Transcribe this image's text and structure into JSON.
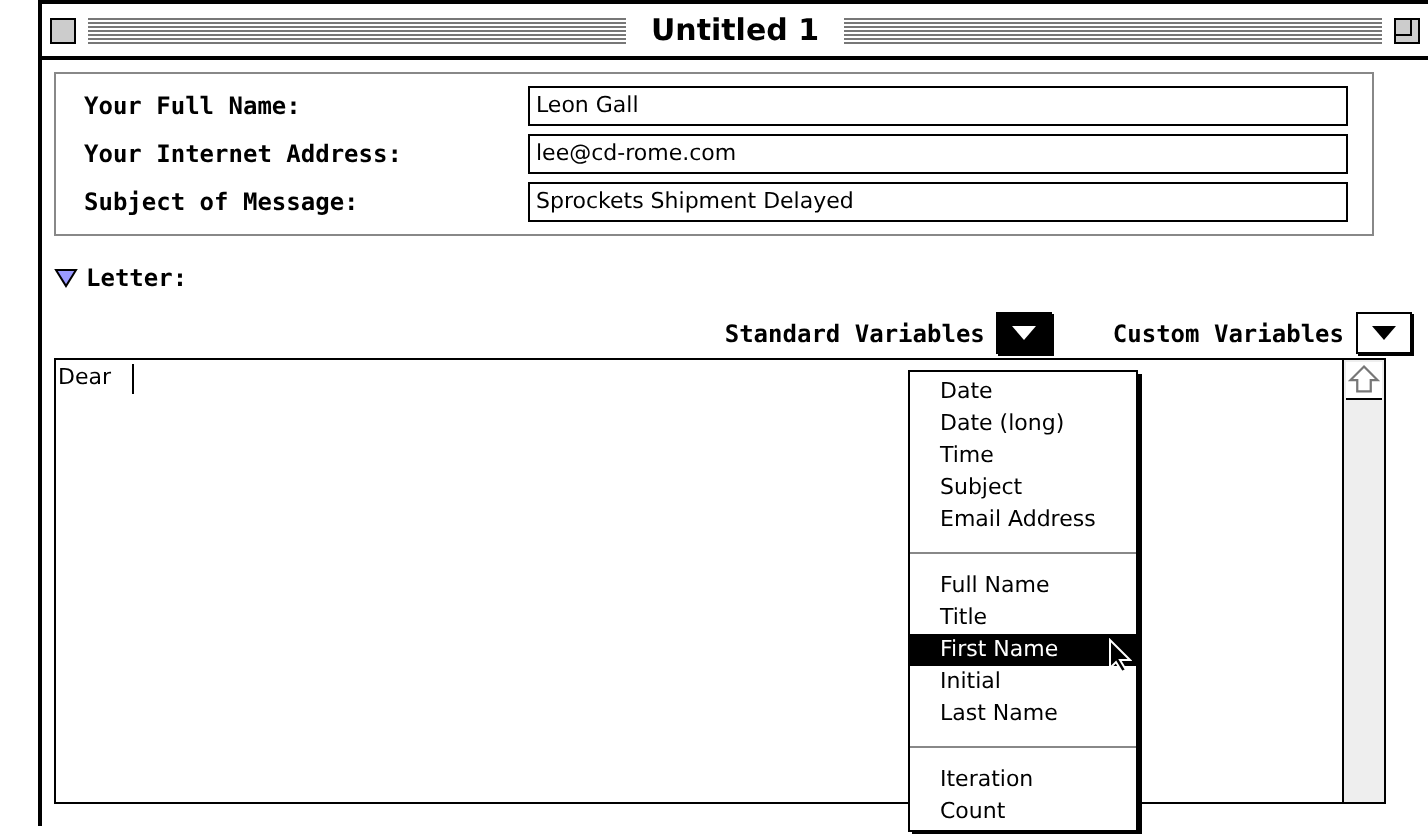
{
  "window": {
    "title": "Untitled 1"
  },
  "fields": [
    {
      "label": "Your Full Name:",
      "value": "Leon Gall"
    },
    {
      "label": "Your Internet Address:",
      "value": "lee@cd-rome.com"
    },
    {
      "label": "Subject of Message:",
      "value": "Sprockets Shipment Delayed"
    }
  ],
  "letter": {
    "label": "Letter:",
    "expanded": true,
    "text": "Dear"
  },
  "variables": [
    {
      "label": "Standard Variables",
      "open": true
    },
    {
      "label": "Custom Variables",
      "open": false
    }
  ],
  "menu": [
    [
      {
        "label": "Date",
        "selected": false
      },
      {
        "label": "Date (long)",
        "selected": false
      },
      {
        "label": "Time",
        "selected": false
      },
      {
        "label": "Subject",
        "selected": false
      },
      {
        "label": "Email Address",
        "selected": false
      }
    ],
    [
      {
        "label": "Full Name",
        "selected": false
      },
      {
        "label": "Title",
        "selected": false
      },
      {
        "label": "First Name",
        "selected": true
      },
      {
        "label": "Initial",
        "selected": false
      },
      {
        "label": "Last Name",
        "selected": false
      }
    ],
    [
      {
        "label": "Iteration",
        "selected": false
      },
      {
        "label": "Count",
        "selected": false
      }
    ]
  ]
}
